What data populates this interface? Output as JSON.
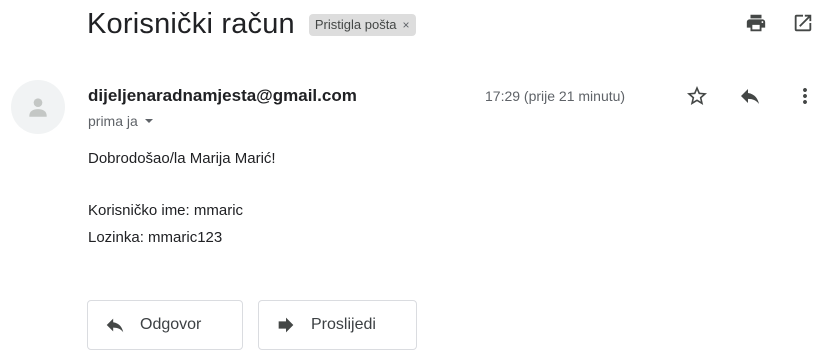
{
  "header": {
    "subject": "Korisnički račun",
    "label_chip": "Pristigla pošta",
    "chip_remove": "×",
    "icons": [
      "print-icon",
      "open-in-new-window-icon"
    ]
  },
  "message": {
    "sender": "dijeljenaradnamjesta@gmail.com",
    "recipient": "prima ja",
    "time": "17:29 (prije 21 minutu)",
    "icons": [
      "star-icon",
      "reply-icon",
      "more-vert-icon",
      "avatar-person-icon",
      "chevron-down-icon"
    ],
    "body": {
      "greeting": "Dobrodošao/la Marija Marić!",
      "username_line": "Korisničko ime: mmaric",
      "password_line": "Lozinka: mmaric123"
    }
  },
  "actions": {
    "reply_label": "Odgovor",
    "forward_label": "Proslijedi",
    "icons": [
      "reply-icon",
      "forward-icon"
    ]
  }
}
